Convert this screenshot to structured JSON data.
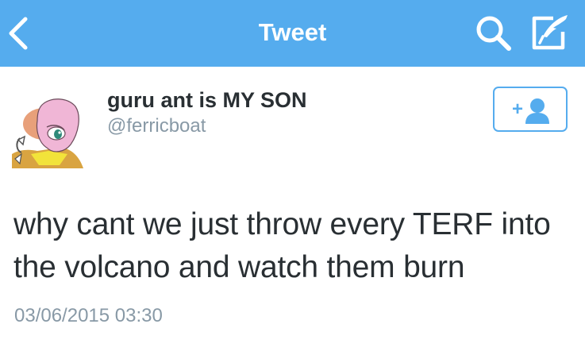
{
  "header": {
    "title": "Tweet",
    "back_icon": "chevron-left-icon",
    "search_icon": "search-icon",
    "compose_icon": "compose-quill-icon",
    "background_color": "#55acee"
  },
  "tweet": {
    "display_name": "guru ant is MY SON",
    "handle": "@ferricboat",
    "text": "why cant we just throw every TERF into the volcano and watch them burn",
    "timestamp": "03/06/2015 03:30",
    "follow_button": {
      "label": "+",
      "icon": "follow-user-icon"
    },
    "avatar": "avatar"
  },
  "colors": {
    "accent": "#55acee",
    "text": "#292f33",
    "secondary_text": "#8899a6"
  }
}
